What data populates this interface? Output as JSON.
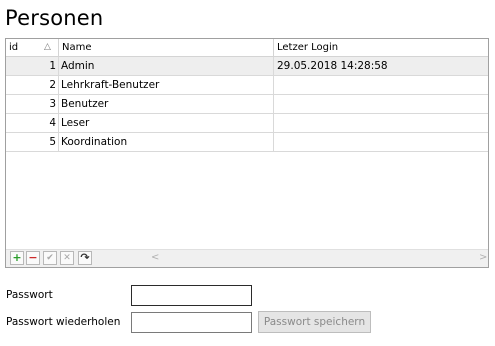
{
  "page": {
    "title": "Personen"
  },
  "grid": {
    "columns": [
      {
        "key": "id",
        "label": "id",
        "sort": "△"
      },
      {
        "key": "name",
        "label": "Name"
      },
      {
        "key": "login",
        "label": "Letzer Login"
      }
    ],
    "rows": [
      {
        "id": "1",
        "name": "Admin",
        "login": "29.05.2018 14:28:58",
        "selected": true
      },
      {
        "id": "2",
        "name": "Lehrkraft-Benutzer",
        "login": ""
      },
      {
        "id": "3",
        "name": "Benutzer",
        "login": ""
      },
      {
        "id": "4",
        "name": "Leser",
        "login": ""
      },
      {
        "id": "5",
        "name": "Koordination",
        "login": ""
      }
    ],
    "toolbar": {
      "add_icon": "plus-icon",
      "remove_icon": "minus-icon",
      "confirm_icon": "check-icon",
      "cancel_icon": "x-icon",
      "refresh_icon": "refresh-icon",
      "add_glyph": "+",
      "remove_glyph": "−",
      "confirm_glyph": "✔",
      "cancel_glyph": "✕",
      "refresh_glyph": "↷",
      "scroll_left": "<",
      "scroll_right": ">"
    }
  },
  "form": {
    "password_label": "Passwort",
    "password_repeat_label": "Passwort wiederholen",
    "password_value": "",
    "password_repeat_value": "",
    "save_button": "Passwort speichern"
  },
  "colors": {
    "add": "#2a9d2a",
    "remove": "#cc2a2a",
    "disabled": "#a8a8a8",
    "selected_row": "#eeeeee"
  }
}
